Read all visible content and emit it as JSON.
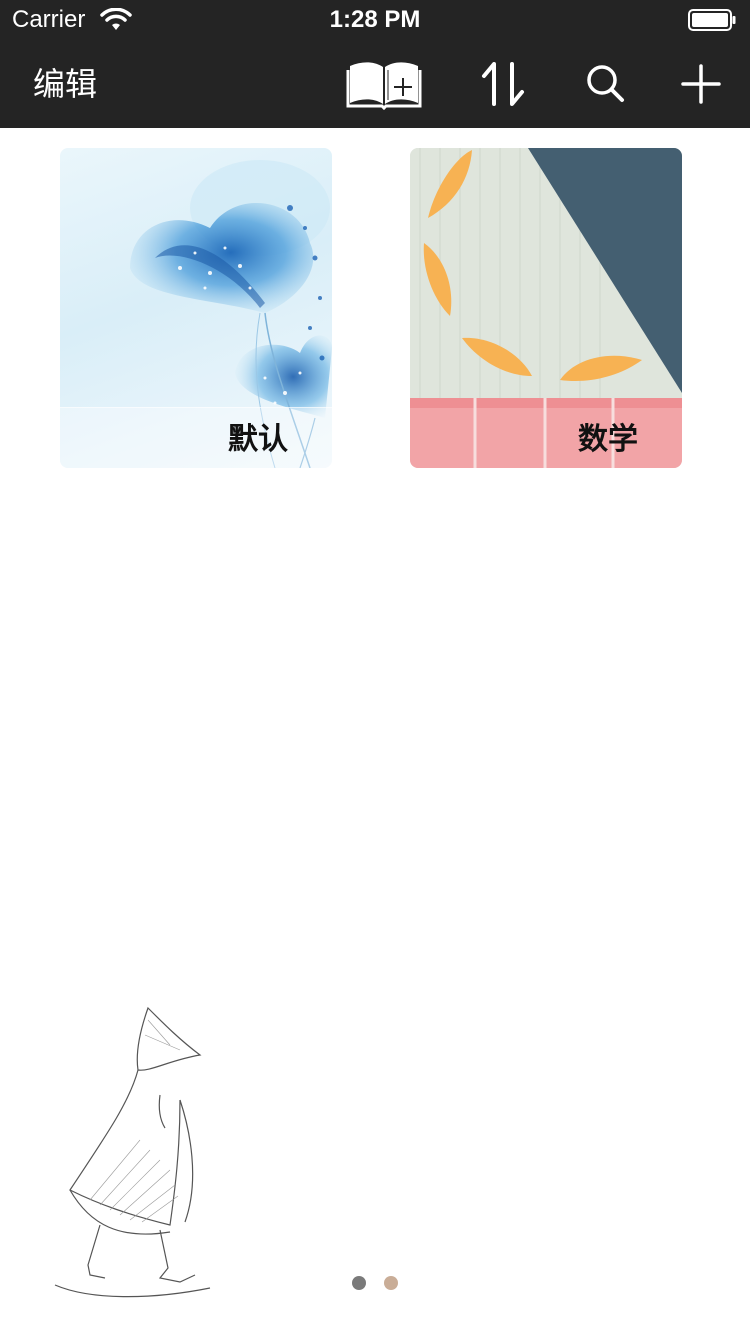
{
  "status_bar": {
    "carrier": "Carrier",
    "time": "1:28 PM"
  },
  "nav_bar": {
    "edit_label": "编辑",
    "icons": [
      "book-add-icon",
      "sort-icon",
      "search-icon",
      "plus-icon"
    ]
  },
  "notebooks": [
    {
      "title": "默认",
      "cover": "blue-flower"
    },
    {
      "title": "数学",
      "cover": "leaves-pink-stripes"
    }
  ],
  "pager": {
    "pages": 2,
    "current": 1,
    "colors": {
      "active": "#7a7a7a",
      "inactive": "#c9ad97"
    }
  },
  "colors": {
    "bar_background": "#242424",
    "background": "#ffffff"
  }
}
